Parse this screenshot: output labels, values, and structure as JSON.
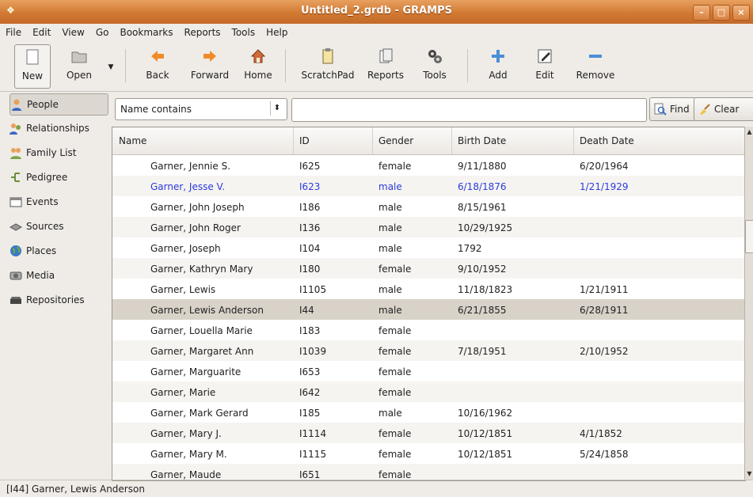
{
  "window": {
    "title": "Untitled_2.grdb - GRAMPS"
  },
  "menu": [
    "File",
    "Edit",
    "View",
    "Go",
    "Bookmarks",
    "Reports",
    "Tools",
    "Help"
  ],
  "toolbar": {
    "new": "New",
    "open": "Open",
    "back": "Back",
    "forward": "Forward",
    "home": "Home",
    "scratchpad": "ScratchPad",
    "reports": "Reports",
    "tools": "Tools",
    "add": "Add",
    "edit": "Edit",
    "remove": "Remove"
  },
  "sidebar": {
    "items": [
      {
        "label": "People",
        "icon": "people-icon"
      },
      {
        "label": "Relationships",
        "icon": "relationships-icon"
      },
      {
        "label": "Family List",
        "icon": "family-icon"
      },
      {
        "label": "Pedigree",
        "icon": "pedigree-icon"
      },
      {
        "label": "Events",
        "icon": "events-icon"
      },
      {
        "label": "Sources",
        "icon": "sources-icon"
      },
      {
        "label": "Places",
        "icon": "globe-icon"
      },
      {
        "label": "Media",
        "icon": "media-icon"
      },
      {
        "label": "Repositories",
        "icon": "repository-icon"
      }
    ]
  },
  "filter": {
    "selected": "Name contains",
    "search_value": "",
    "find": "Find",
    "clear": "Clear"
  },
  "table": {
    "columns": [
      "Name",
      "ID",
      "Gender",
      "Birth Date",
      "Death Date"
    ],
    "rows": [
      [
        "Garner, Jennie S.",
        "I625",
        "female",
        "9/11/1880",
        "6/20/1964"
      ],
      [
        "Garner, Jesse V.",
        "I623",
        "male",
        "6/18/1876",
        "1/21/1929"
      ],
      [
        "Garner, John Joseph",
        "I186",
        "male",
        "8/15/1961",
        ""
      ],
      [
        "Garner, John Roger",
        "I136",
        "male",
        "10/29/1925",
        ""
      ],
      [
        "Garner, Joseph",
        "I104",
        "male",
        "1792",
        ""
      ],
      [
        "Garner, Kathryn Mary",
        "I180",
        "female",
        "9/10/1952",
        ""
      ],
      [
        "Garner, Lewis",
        "I1105",
        "male",
        "11/18/1823",
        "1/21/1911"
      ],
      [
        "Garner, Lewis Anderson",
        "I44",
        "male",
        "6/21/1855",
        "6/28/1911"
      ],
      [
        "Garner, Louella Marie",
        "I183",
        "female",
        "",
        ""
      ],
      [
        "Garner, Margaret Ann",
        "I1039",
        "female",
        "7/18/1951",
        "2/10/1952"
      ],
      [
        "Garner, Marguarite",
        "I653",
        "female",
        "",
        ""
      ],
      [
        "Garner, Marie",
        "I642",
        "female",
        "",
        ""
      ],
      [
        "Garner, Mark Gerard",
        "I185",
        "male",
        "10/16/1962",
        ""
      ],
      [
        "Garner, Mary J.",
        "I1114",
        "female",
        "10/12/1851",
        "4/1/1852"
      ],
      [
        "Garner, Mary M.",
        "I1115",
        "female",
        "10/12/1851",
        "5/24/1858"
      ],
      [
        "Garner, Maude",
        "I651",
        "female",
        "",
        ""
      ]
    ],
    "selected_row": 7,
    "highlight_row": 1,
    "highlight_color": "#2a3bdc"
  },
  "status": {
    "text": "[I44] Garner, Lewis Anderson"
  }
}
